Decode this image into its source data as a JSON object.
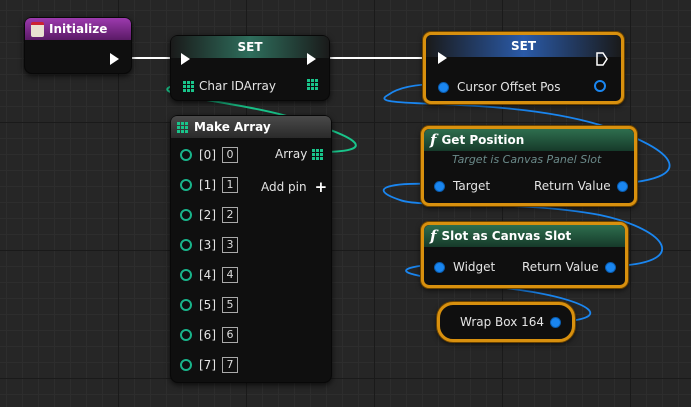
{
  "nodes": {
    "initialize": {
      "title": "Initialize",
      "header_color": "#7a2a8a"
    },
    "set_char": {
      "title": "SET",
      "pin_label": "Char IDArray"
    },
    "set_cursor": {
      "title": "SET",
      "pin_label": "Cursor Offset Pos"
    },
    "make_array": {
      "title": "Make Array",
      "output_label": "Array",
      "add_pin_label": "Add pin",
      "add_pin_icon": "+",
      "inputs": [
        {
          "label": "[0]",
          "value": "0"
        },
        {
          "label": "[1]",
          "value": "1"
        },
        {
          "label": "[2]",
          "value": "2"
        },
        {
          "label": "[3]",
          "value": "3"
        },
        {
          "label": "[4]",
          "value": "4"
        },
        {
          "label": "[5]",
          "value": "5"
        },
        {
          "label": "[6]",
          "value": "6"
        },
        {
          "label": "[7]",
          "value": "7"
        }
      ]
    },
    "get_position": {
      "title": "Get Position",
      "subtitle": "Target is Canvas Panel Slot",
      "input_label": "Target",
      "output_label": "Return Value"
    },
    "slot_as_canvas": {
      "title": "Slot as Canvas Slot",
      "input_label": "Widget",
      "output_label": "Return Value"
    },
    "wrap_box": {
      "label": "Wrap Box 164"
    }
  },
  "function_icon": "f",
  "colors": {
    "exec_wire": "#ffffff",
    "object_wire": "#1a86f0",
    "array_wire": "#19c48a",
    "selection": "#d8900e"
  }
}
